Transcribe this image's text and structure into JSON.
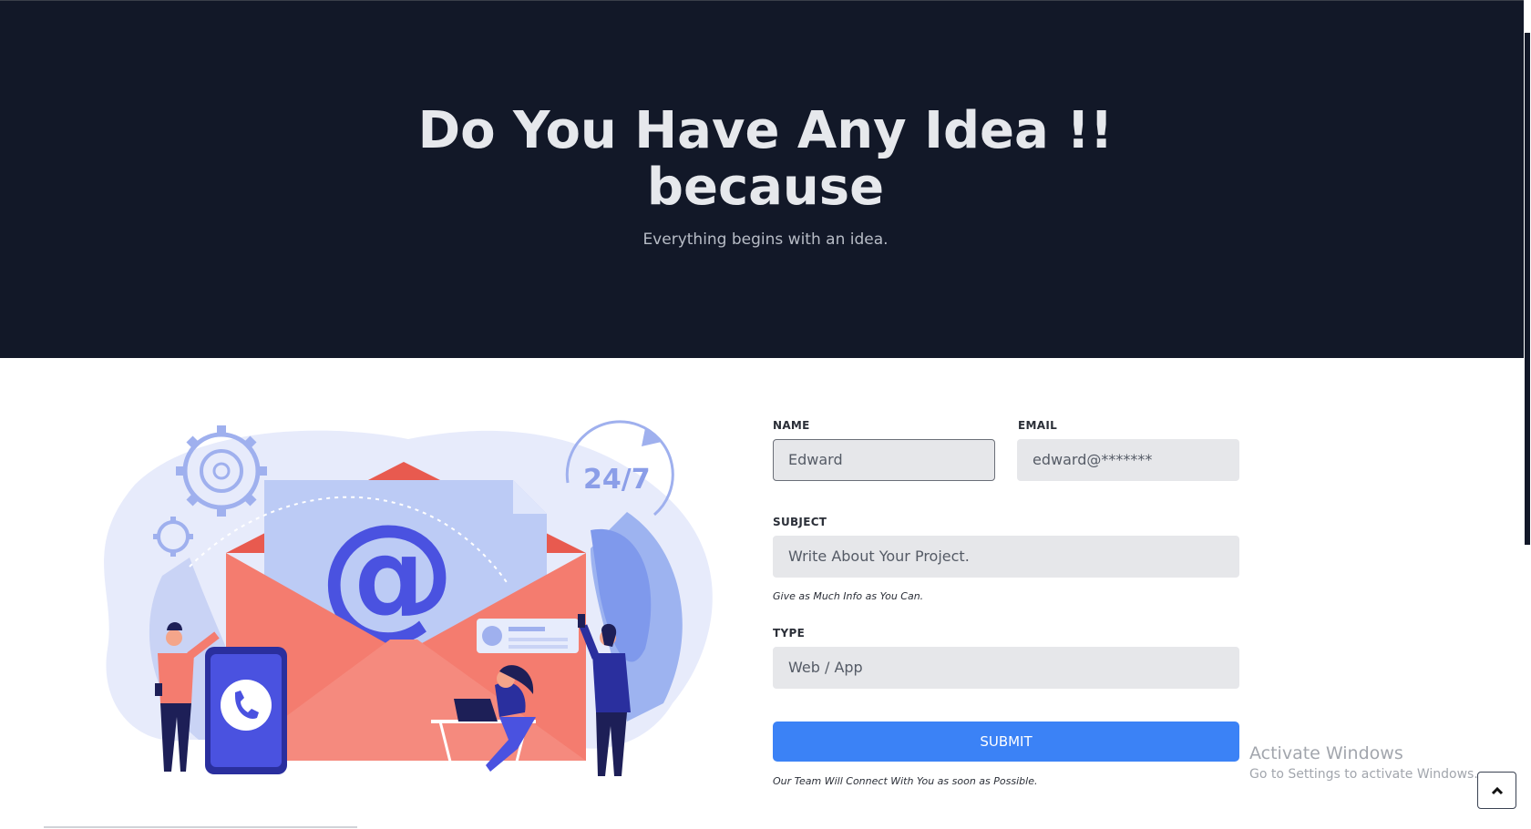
{
  "hero": {
    "title_line1": "Do You Have Any Idea !!",
    "title_line2": "because",
    "subtitle": "Everything begins with an idea."
  },
  "illustration": {
    "badge": "24/7",
    "at_symbol": "@"
  },
  "form": {
    "name": {
      "label": "NAME",
      "value": "Edward"
    },
    "email": {
      "label": "EMAIL",
      "value": "edward@*******"
    },
    "subject": {
      "label": "SUBJECT",
      "placeholder": "Write About Your Project.",
      "hint": "Give as Much Info as You Can."
    },
    "type": {
      "label": "TYPE",
      "placeholder": "Web / App"
    },
    "submit_label": "SUBMIT",
    "footer_note": "Our Team Will Connect With You as soon as Possible."
  },
  "watermark": {
    "title": "Activate Windows",
    "subtitle": "Go to Settings to activate Windows."
  },
  "icons": {
    "back_to_top": "chevron-up-icon"
  },
  "colors": {
    "hero_bg": "#121828",
    "accent": "#3b82f6",
    "envelope": "#f47c6f",
    "illustration_blue": "#4a52e0"
  }
}
